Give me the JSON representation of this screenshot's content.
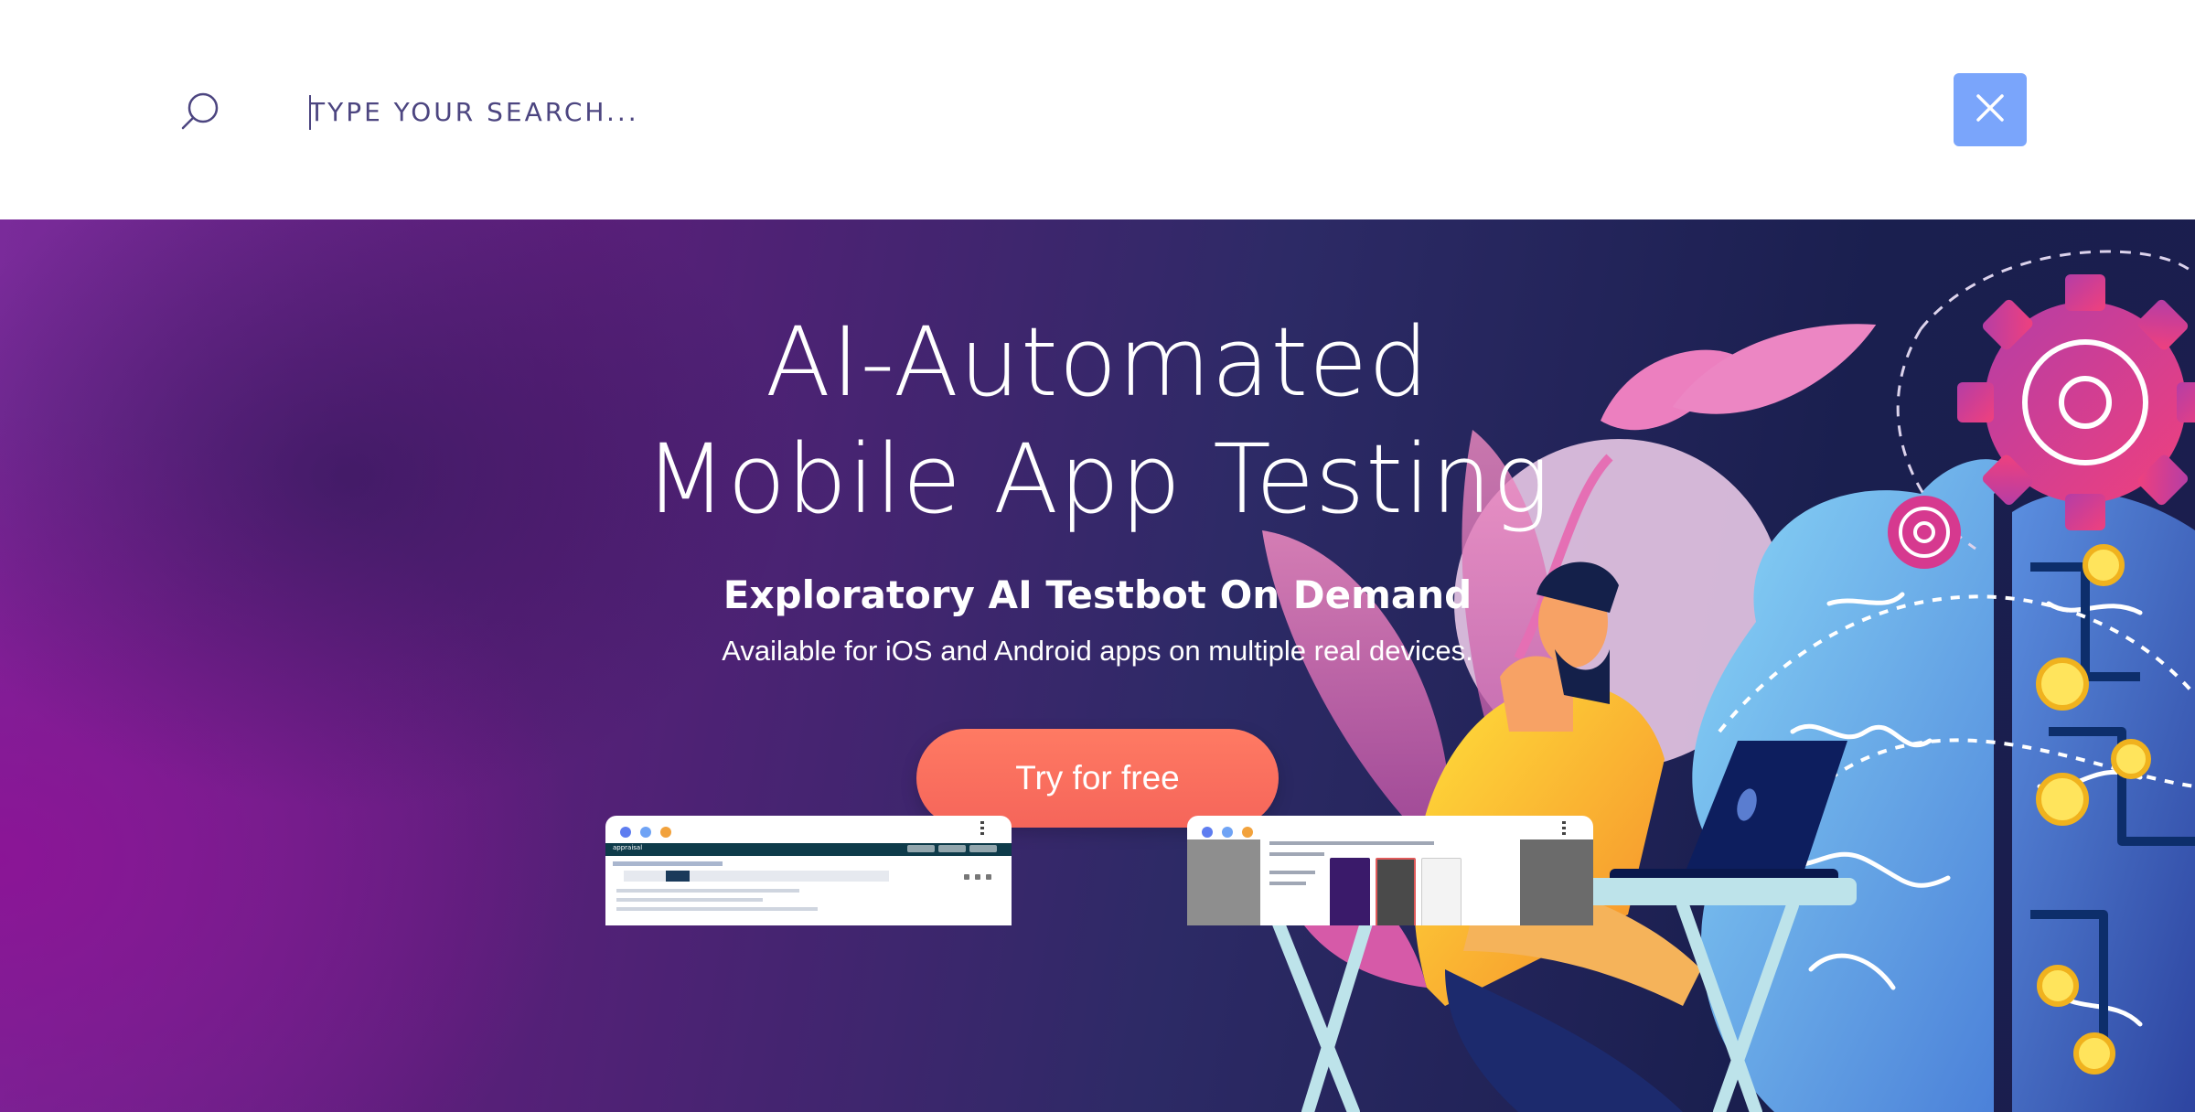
{
  "search": {
    "placeholder": "TYPE YOUR SEARCH...",
    "value": ""
  },
  "hero": {
    "title_line1": "AI-Automated",
    "title_line2": "Mobile App Testing",
    "subtitle": "Exploratory AI Testbot On Demand",
    "description": "Available for iOS and Android apps on multiple real devices.",
    "cta_label": "Try for free"
  },
  "icons": {
    "search": "search-icon",
    "close": "close-icon"
  },
  "colors": {
    "close_button": "#7aa5fb",
    "cta": "#f8695c",
    "search_text": "#4c4580",
    "hero_left": "#7a2b9a",
    "hero_right": "#1b1e4d",
    "gear": "#d6398f",
    "brain_left": "#6ec8f5",
    "brain_right": "#3f64c8"
  },
  "previews": {
    "first_logo": "appraisal"
  }
}
